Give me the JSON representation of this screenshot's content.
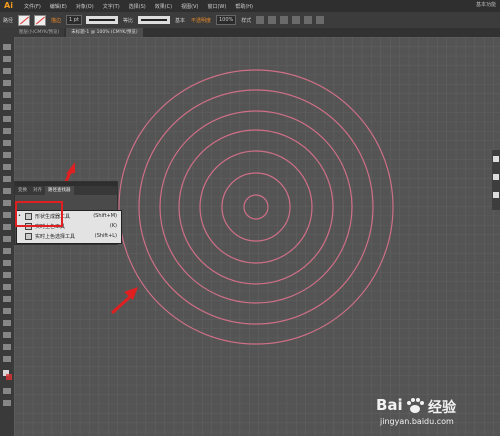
{
  "app": {
    "logo": "Ai"
  },
  "menu": {
    "items": [
      "文件(F)",
      "编辑(E)",
      "对象(O)",
      "文字(T)",
      "选择(S)",
      "效果(C)",
      "视图(V)",
      "窗口(W)",
      "帮助(H)"
    ],
    "right_text": "基本功能"
  },
  "control_bar": {
    "label": "路径",
    "stroke_label": "描边",
    "stroke_weight": "1 pt",
    "profile_label": "等比",
    "brush_label": "基本",
    "opacity_label": "不透明度",
    "opacity_value": "100%",
    "style_label": "样式"
  },
  "document_tabs": [
    {
      "label": "图层小(CMYK/预览)"
    },
    {
      "label": "未标题-1 @ 100% (CMYK/预览)"
    }
  ],
  "panel": {
    "tabs": [
      "变换",
      "对齐",
      "路径查找器"
    ]
  },
  "flyout": {
    "items": [
      {
        "bullet": "•",
        "label": "形状生成器工具",
        "shortcut": "(Shift+M)"
      },
      {
        "bullet": "",
        "label": "实时上色工具",
        "shortcut": "(K)"
      },
      {
        "bullet": "",
        "label": "实时上色选择工具",
        "shortcut": "(Shift+L)"
      }
    ]
  },
  "watermark": {
    "brand": "Bai",
    "brand_suffix": "经验",
    "url": "jingyan.baidu.com"
  },
  "colors": {
    "ring": "#cf6f87",
    "annotation": "#e02020",
    "grid": "#6a6a6a"
  }
}
